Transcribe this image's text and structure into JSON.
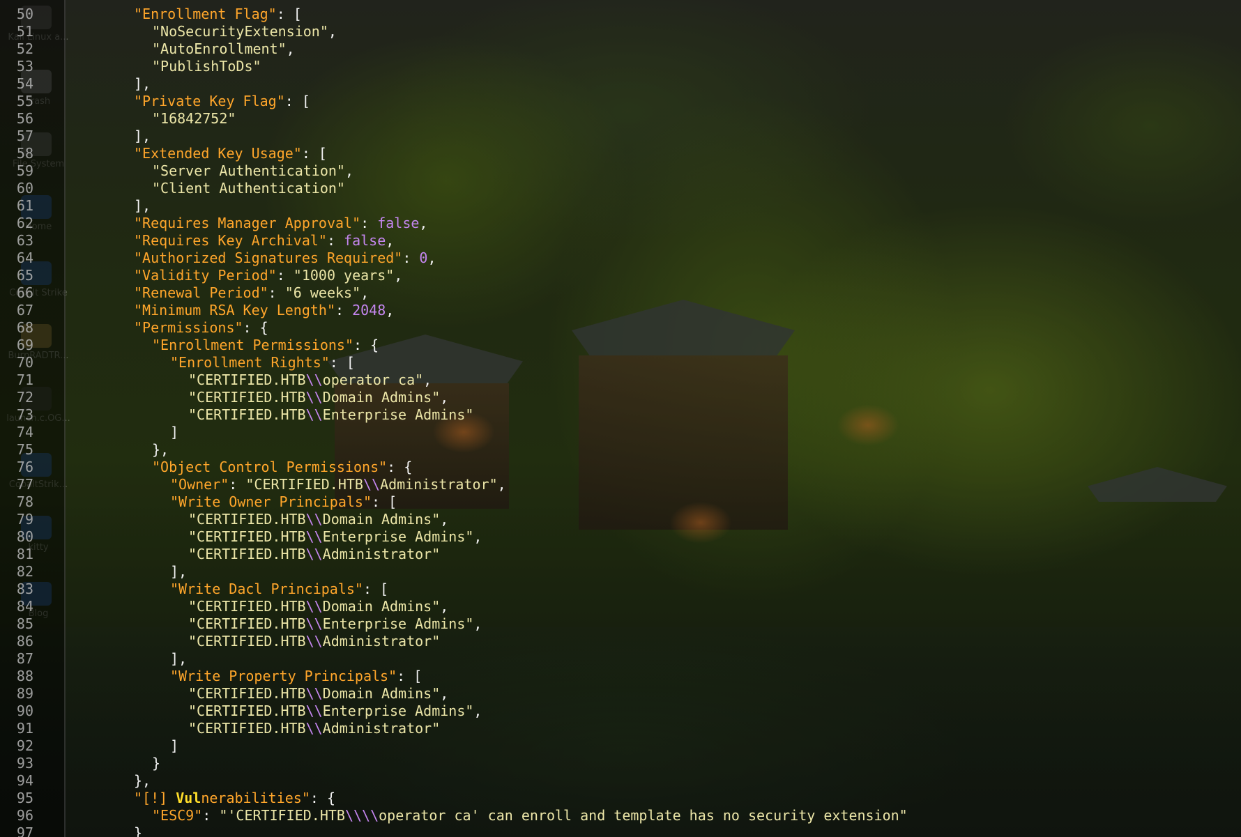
{
  "desktop": {
    "icons": [
      {
        "name": "kali-linux-icon",
        "label": "Kali Linux a...",
        "color": "#6f6f6f"
      },
      {
        "name": "trash-icon",
        "label": "Trash",
        "color": "#9a9a9a"
      },
      {
        "name": "file-system-icon",
        "label": "File System",
        "color": "#7a7a7a"
      },
      {
        "name": "home-folder-icon",
        "label": "Home",
        "color": "#2f6fd6"
      },
      {
        "name": "cobalt-strike-folder-icon",
        "label": "Cobalt Strike",
        "color": "#2f6fd6"
      },
      {
        "name": "burp-file-icon",
        "label": "BurpRADTR...",
        "color": "#c9a74a"
      },
      {
        "name": "launcher-icon",
        "label": "launch.c.OG...",
        "color": "#444444"
      },
      {
        "name": "cobalt-strike-folder-2-icon",
        "label": "CobaltStrik...",
        "color": "#2f6fd6"
      },
      {
        "name": "kitty-folder-icon",
        "label": "kitty",
        "color": "#2f6fd6"
      },
      {
        "name": "blog-folder-icon",
        "label": "Blog",
        "color": "#2f6fd6"
      }
    ]
  },
  "terminal": {
    "colors": {
      "key": "#ffa62b",
      "string": "#ece6a8",
      "punctuation": "#f2f2f2",
      "literal": "#c586f0",
      "highlight": "#ffde2a",
      "line_number": "#b7b7b7"
    },
    "lines": [
      {
        "n": "50",
        "indent": 0,
        "tokens": [
          [
            "k",
            "\"Enrollment Flag\""
          ],
          [
            "p",
            ": ["
          ]
        ]
      },
      {
        "n": "51",
        "indent": 1,
        "tokens": [
          [
            "s",
            "\"NoSecurityExtension\""
          ],
          [
            "p",
            ","
          ]
        ]
      },
      {
        "n": "52",
        "indent": 1,
        "tokens": [
          [
            "s",
            "\"AutoEnrollment\""
          ],
          [
            "p",
            ","
          ]
        ]
      },
      {
        "n": "53",
        "indent": 1,
        "tokens": [
          [
            "s",
            "\"PublishToDs\""
          ]
        ]
      },
      {
        "n": "54",
        "indent": 0,
        "tokens": [
          [
            "p",
            "],"
          ]
        ]
      },
      {
        "n": "55",
        "indent": 0,
        "tokens": [
          [
            "k",
            "\"Private Key Flag\""
          ],
          [
            "p",
            ": ["
          ]
        ]
      },
      {
        "n": "56",
        "indent": 1,
        "tokens": [
          [
            "s",
            "\"16842752\""
          ]
        ]
      },
      {
        "n": "57",
        "indent": 0,
        "tokens": [
          [
            "p",
            "],"
          ]
        ]
      },
      {
        "n": "58",
        "indent": 0,
        "tokens": [
          [
            "k",
            "\"Extended Key Usage\""
          ],
          [
            "p",
            ": ["
          ]
        ]
      },
      {
        "n": "59",
        "indent": 1,
        "tokens": [
          [
            "s",
            "\"Server Authentication\""
          ],
          [
            "p",
            ","
          ]
        ]
      },
      {
        "n": "60",
        "indent": 1,
        "tokens": [
          [
            "s",
            "\"Client Authentication\""
          ]
        ]
      },
      {
        "n": "61",
        "indent": 0,
        "tokens": [
          [
            "p",
            "],"
          ]
        ]
      },
      {
        "n": "62",
        "indent": 0,
        "tokens": [
          [
            "k",
            "\"Requires Manager Approval\""
          ],
          [
            "p",
            ": "
          ],
          [
            "b",
            "false"
          ],
          [
            "p",
            ","
          ]
        ]
      },
      {
        "n": "63",
        "indent": 0,
        "tokens": [
          [
            "k",
            "\"Requires Key Archival\""
          ],
          [
            "p",
            ": "
          ],
          [
            "b",
            "false"
          ],
          [
            "p",
            ","
          ]
        ]
      },
      {
        "n": "64",
        "indent": 0,
        "tokens": [
          [
            "k",
            "\"Authorized Signatures Required\""
          ],
          [
            "p",
            ": "
          ],
          [
            "n",
            "0"
          ],
          [
            "p",
            ","
          ]
        ]
      },
      {
        "n": "65",
        "indent": 0,
        "tokens": [
          [
            "k",
            "\"Validity Period\""
          ],
          [
            "p",
            ": "
          ],
          [
            "s",
            "\"1000 years\""
          ],
          [
            "p",
            ","
          ]
        ]
      },
      {
        "n": "66",
        "indent": 0,
        "tokens": [
          [
            "k",
            "\"Renewal Period\""
          ],
          [
            "p",
            ": "
          ],
          [
            "s",
            "\"6 weeks\""
          ],
          [
            "p",
            ","
          ]
        ]
      },
      {
        "n": "67",
        "indent": 0,
        "tokens": [
          [
            "k",
            "\"Minimum RSA Key Length\""
          ],
          [
            "p",
            ": "
          ],
          [
            "n",
            "2048"
          ],
          [
            "p",
            ","
          ]
        ]
      },
      {
        "n": "68",
        "indent": 0,
        "tokens": [
          [
            "k",
            "\"Permissions\""
          ],
          [
            "p",
            ": {"
          ]
        ]
      },
      {
        "n": "69",
        "indent": 1,
        "tokens": [
          [
            "k",
            "\"Enrollment Permissions\""
          ],
          [
            "p",
            ": {"
          ]
        ]
      },
      {
        "n": "70",
        "indent": 2,
        "tokens": [
          [
            "k",
            "\"Enrollment Rights\""
          ],
          [
            "p",
            ": ["
          ]
        ]
      },
      {
        "n": "71",
        "indent": 3,
        "tokens": [
          [
            "s",
            "\"CERTIFIED.HTB"
          ],
          [
            "e",
            "\\\\"
          ],
          [
            "s",
            "operator ca\""
          ],
          [
            "p",
            ","
          ]
        ]
      },
      {
        "n": "72",
        "indent": 3,
        "tokens": [
          [
            "s",
            "\"CERTIFIED.HTB"
          ],
          [
            "e",
            "\\\\"
          ],
          [
            "s",
            "Domain Admins\""
          ],
          [
            "p",
            ","
          ]
        ]
      },
      {
        "n": "73",
        "indent": 3,
        "tokens": [
          [
            "s",
            "\"CERTIFIED.HTB"
          ],
          [
            "e",
            "\\\\"
          ],
          [
            "s",
            "Enterprise Admins\""
          ]
        ]
      },
      {
        "n": "74",
        "indent": 2,
        "tokens": [
          [
            "p",
            "]"
          ]
        ]
      },
      {
        "n": "75",
        "indent": 1,
        "tokens": [
          [
            "p",
            "},"
          ]
        ]
      },
      {
        "n": "76",
        "indent": 1,
        "tokens": [
          [
            "k",
            "\"Object Control Permissions\""
          ],
          [
            "p",
            ": {"
          ]
        ]
      },
      {
        "n": "77",
        "indent": 2,
        "tokens": [
          [
            "k",
            "\"Owner\""
          ],
          [
            "p",
            ": "
          ],
          [
            "s",
            "\"CERTIFIED.HTB"
          ],
          [
            "e",
            "\\\\"
          ],
          [
            "s",
            "Administrator\""
          ],
          [
            "p",
            ","
          ]
        ]
      },
      {
        "n": "78",
        "indent": 2,
        "tokens": [
          [
            "k",
            "\"Write Owner Principals\""
          ],
          [
            "p",
            ": ["
          ]
        ]
      },
      {
        "n": "79",
        "indent": 3,
        "tokens": [
          [
            "s",
            "\"CERTIFIED.HTB"
          ],
          [
            "e",
            "\\\\"
          ],
          [
            "s",
            "Domain Admins\""
          ],
          [
            "p",
            ","
          ]
        ]
      },
      {
        "n": "80",
        "indent": 3,
        "tokens": [
          [
            "s",
            "\"CERTIFIED.HTB"
          ],
          [
            "e",
            "\\\\"
          ],
          [
            "s",
            "Enterprise Admins\""
          ],
          [
            "p",
            ","
          ]
        ]
      },
      {
        "n": "81",
        "indent": 3,
        "tokens": [
          [
            "s",
            "\"CERTIFIED.HTB"
          ],
          [
            "e",
            "\\\\"
          ],
          [
            "s",
            "Administrator\""
          ]
        ]
      },
      {
        "n": "82",
        "indent": 2,
        "tokens": [
          [
            "p",
            "],"
          ]
        ]
      },
      {
        "n": "83",
        "indent": 2,
        "tokens": [
          [
            "k",
            "\"Write Dacl Principals\""
          ],
          [
            "p",
            ": ["
          ]
        ]
      },
      {
        "n": "84",
        "indent": 3,
        "tokens": [
          [
            "s",
            "\"CERTIFIED.HTB"
          ],
          [
            "e",
            "\\\\"
          ],
          [
            "s",
            "Domain Admins\""
          ],
          [
            "p",
            ","
          ]
        ]
      },
      {
        "n": "85",
        "indent": 3,
        "tokens": [
          [
            "s",
            "\"CERTIFIED.HTB"
          ],
          [
            "e",
            "\\\\"
          ],
          [
            "s",
            "Enterprise Admins\""
          ],
          [
            "p",
            ","
          ]
        ]
      },
      {
        "n": "86",
        "indent": 3,
        "tokens": [
          [
            "s",
            "\"CERTIFIED.HTB"
          ],
          [
            "e",
            "\\\\"
          ],
          [
            "s",
            "Administrator\""
          ]
        ]
      },
      {
        "n": "87",
        "indent": 2,
        "tokens": [
          [
            "p",
            "],"
          ]
        ]
      },
      {
        "n": "88",
        "indent": 2,
        "tokens": [
          [
            "k",
            "\"Write Property Principals\""
          ],
          [
            "p",
            ": ["
          ]
        ]
      },
      {
        "n": "89",
        "indent": 3,
        "tokens": [
          [
            "s",
            "\"CERTIFIED.HTB"
          ],
          [
            "e",
            "\\\\"
          ],
          [
            "s",
            "Domain Admins\""
          ],
          [
            "p",
            ","
          ]
        ]
      },
      {
        "n": "90",
        "indent": 3,
        "tokens": [
          [
            "s",
            "\"CERTIFIED.HTB"
          ],
          [
            "e",
            "\\\\"
          ],
          [
            "s",
            "Enterprise Admins\""
          ],
          [
            "p",
            ","
          ]
        ]
      },
      {
        "n": "91",
        "indent": 3,
        "tokens": [
          [
            "s",
            "\"CERTIFIED.HTB"
          ],
          [
            "e",
            "\\\\"
          ],
          [
            "s",
            "Administrator\""
          ]
        ]
      },
      {
        "n": "92",
        "indent": 2,
        "tokens": [
          [
            "p",
            "]"
          ]
        ]
      },
      {
        "n": "93",
        "indent": 1,
        "tokens": [
          [
            "p",
            "}"
          ]
        ]
      },
      {
        "n": "94",
        "indent": 0,
        "tokens": [
          [
            "p",
            "},"
          ]
        ]
      },
      {
        "n": "95",
        "indent": 0,
        "tokens": [
          [
            "k",
            "\"[!] "
          ],
          [
            "vh",
            "Vul"
          ],
          [
            "k",
            "nerabilities\""
          ],
          [
            "p",
            ": {"
          ]
        ]
      },
      {
        "n": "96",
        "indent": 1,
        "tokens": [
          [
            "k",
            "\"ESC9\""
          ],
          [
            "p",
            ": "
          ],
          [
            "s",
            "\"'CERTIFIED.HTB"
          ],
          [
            "e",
            "\\\\\\\\"
          ],
          [
            "s",
            "operator ca' can enroll and template has no security extension\""
          ]
        ]
      },
      {
        "n": "97",
        "indent": 0,
        "tokens": [
          [
            "p",
            "}"
          ]
        ]
      }
    ]
  }
}
